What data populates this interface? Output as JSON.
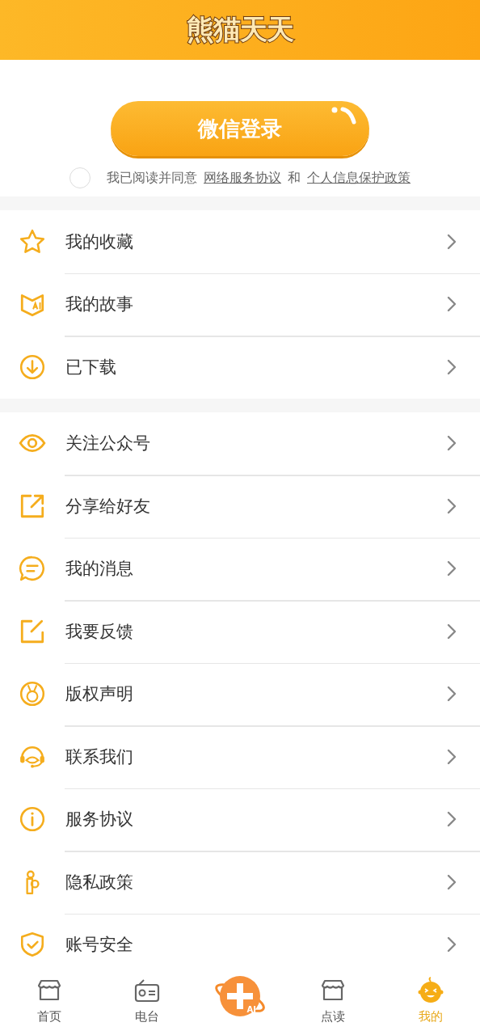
{
  "header": {
    "title": "熊猫天天"
  },
  "login": {
    "button": "微信登录",
    "agreement": {
      "checked": false,
      "prefix": "我已阅读并同意",
      "link1": "网络服务协议",
      "joiner": "和",
      "link2": "个人信息保护政策"
    }
  },
  "menu_groups": [
    {
      "items": [
        {
          "label": "我的收藏"
        },
        {
          "label": "我的故事"
        },
        {
          "label": "已下载"
        }
      ]
    },
    {
      "items": [
        {
          "label": "关注公众号"
        },
        {
          "label": "分享给好友"
        },
        {
          "label": "我的消息"
        },
        {
          "label": "我要反馈"
        },
        {
          "label": "版权声明"
        },
        {
          "label": "联系我们"
        },
        {
          "label": "服务协议"
        },
        {
          "label": "隐私政策"
        },
        {
          "label": "账号安全"
        }
      ]
    }
  ],
  "tab_bar": [
    {
      "kind": "tab",
      "label": "首页",
      "selected": false
    },
    {
      "kind": "tab",
      "label": "电台",
      "selected": false
    },
    {
      "kind": "center",
      "badge": "AI"
    },
    {
      "kind": "tab",
      "label": "点读",
      "selected": false
    },
    {
      "kind": "tab",
      "label": "我的",
      "selected": true
    }
  ]
}
